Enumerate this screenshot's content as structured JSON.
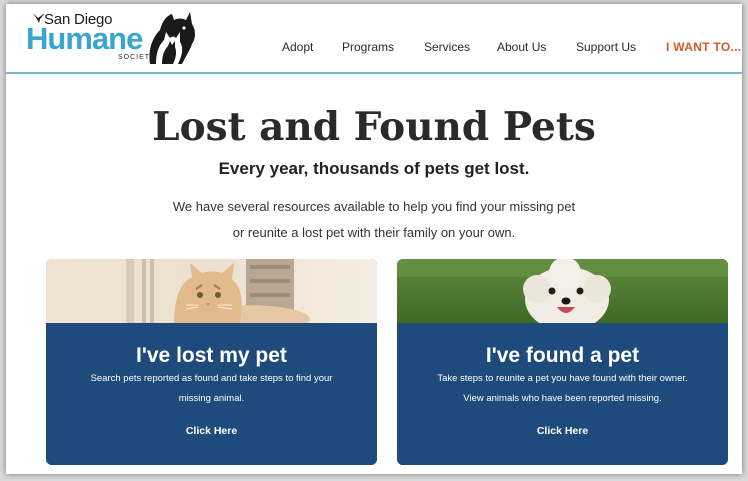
{
  "brand": {
    "line1": "San Diego",
    "line2": "Humane",
    "line3": "SOCIETY"
  },
  "nav": {
    "items": [
      "Adopt",
      "Programs",
      "Services",
      "About Us",
      "Support Us"
    ],
    "cta": "I WANT TO..."
  },
  "hero": {
    "title": "Lost and Found Pets",
    "subtitle": "Every year, thousands of pets get lost.",
    "desc_line1": "We have several resources available to help you find your missing pet",
    "desc_line2": "or reunite a lost pet with their family on your own."
  },
  "cards": [
    {
      "title": "I've lost my pet",
      "text_line1": "Search pets reported as found and take steps to find your",
      "text_line2": "missing animal.",
      "link": "Click Here"
    },
    {
      "title": "I've found a pet",
      "text_line1": "Take steps to reunite a pet you have found with their owner.",
      "text_line2": "View animals who have been reported missing.",
      "link": "Click Here"
    }
  ],
  "colors": {
    "brand_blue": "#3aa5d1",
    "card_navy": "#1f4b7c",
    "cta_orange": "#d45a25",
    "header_rule": "#7fb6cf"
  }
}
